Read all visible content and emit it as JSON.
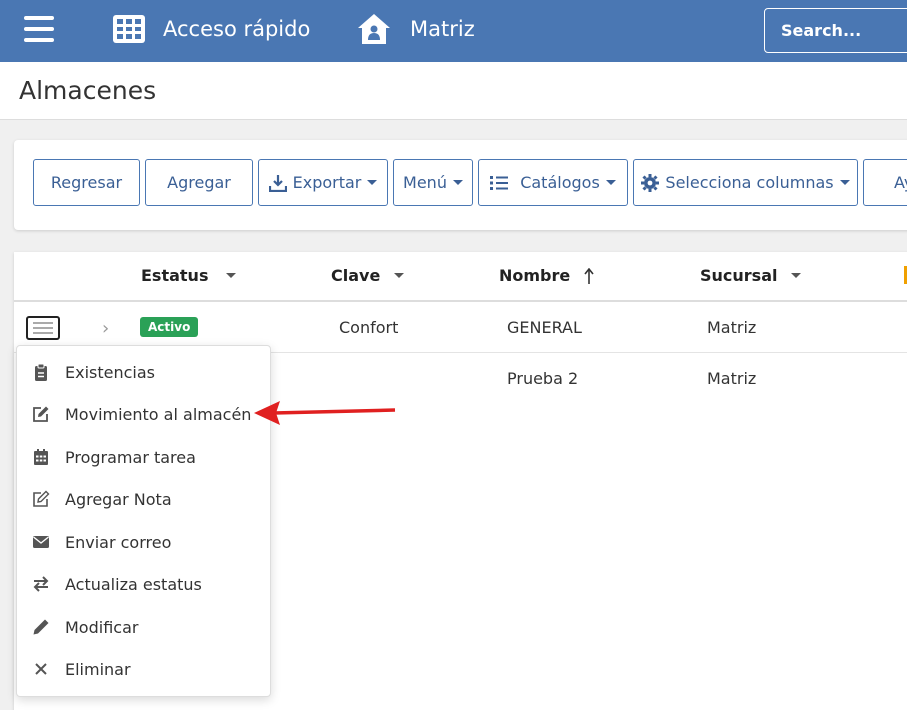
{
  "topbar": {
    "menu_icon": "hamburger-icon",
    "quick_access_icon": "grid-icon",
    "quick_access_label": "Acceso rápido",
    "branch_icon": "house-icon",
    "branch_label": "Matriz",
    "search_placeholder": "Search..."
  },
  "page": {
    "title": "Almacenes"
  },
  "toolbar": {
    "regresar": "Regresar",
    "agregar": "Agregar",
    "exportar": "Exportar",
    "menu": "Menú",
    "catalogos": "Catálogos",
    "selecciona_columnas": "Selecciona columnas",
    "ayuda_partial": "Ay"
  },
  "table": {
    "headers": {
      "estatus": "Estatus",
      "clave": "Clave",
      "nombre": "Nombre",
      "sucursal": "Sucursal"
    },
    "rows": [
      {
        "estatus": "Activo",
        "clave": "Confort",
        "nombre": "GENERAL",
        "sucursal": "Matriz"
      },
      {
        "estatus": "",
        "clave": "",
        "nombre": "Prueba 2",
        "sucursal": "Matriz"
      }
    ]
  },
  "row_menu": {
    "items": [
      {
        "label": "Existencias",
        "icon": "clipboard-icon"
      },
      {
        "label": "Movimiento al almacén",
        "icon": "edit-icon"
      },
      {
        "label": "Programar tarea",
        "icon": "calendar-icon"
      },
      {
        "label": "Agregar Nota",
        "icon": "note-edit-icon"
      },
      {
        "label": "Enviar correo",
        "icon": "envelope-icon"
      },
      {
        "label": "Actualiza estatus",
        "icon": "exchange-icon"
      },
      {
        "label": "Modificar",
        "icon": "pencil-icon"
      },
      {
        "label": "Eliminar",
        "icon": "close-icon"
      }
    ]
  },
  "colors": {
    "topbar": "#4a77b3",
    "active_badge": "#2aa157",
    "annotation_arrow": "#e02020"
  }
}
